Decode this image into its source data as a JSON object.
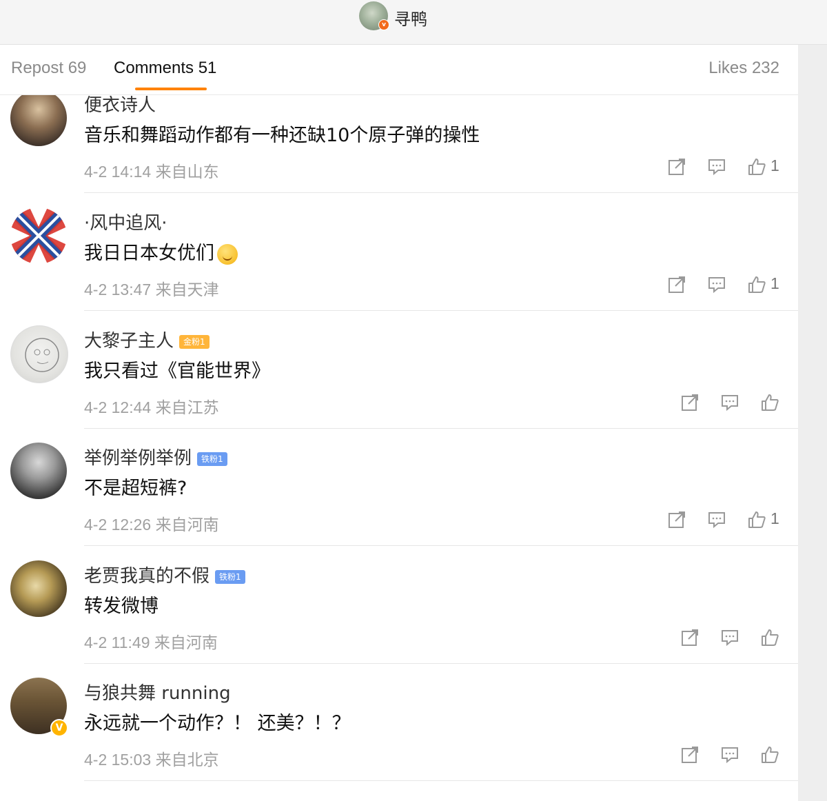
{
  "header": {
    "title": "寻鸭",
    "avatar_badge": "v"
  },
  "tabs": {
    "repost": "Repost 69",
    "comments": "Comments 51",
    "likes": "Likes 232"
  },
  "colors": {
    "accent": "#ff8200",
    "gold_fan": "#ffb53a",
    "iron_fan": "#6a9cf2",
    "verified": "#ffb400"
  },
  "comments": [
    {
      "user": "便衣诗人",
      "text": "音乐和舞蹈动作都有一种还缺10个原子弹的操性",
      "time": "4-2 14:14 来自山东",
      "likes": "1"
    },
    {
      "user": "·风中追风·",
      "text": "我日日本女优们",
      "emoji": "smirk-emoji",
      "time": "4-2 13:47 来自天津",
      "likes": "1"
    },
    {
      "user": "大黎子主人",
      "badge": "金粉1",
      "text": "我只看过《官能世界》",
      "time": "4-2 12:44 来自江苏",
      "likes": ""
    },
    {
      "user": "举例举例举例",
      "badge": "铁粉1",
      "text": "不是超短裤?",
      "time": "4-2 12:26 来自河南",
      "likes": "1"
    },
    {
      "user": "老贾我真的不假",
      "badge": "铁粉1",
      "text": "转发微博",
      "time": "4-2 11:49 来自河南",
      "likes": ""
    },
    {
      "user": "与狼共舞 running",
      "verified": "V",
      "text": "永远就一个动作？！ 还美？！？",
      "time": "4-2 15:03 来自北京",
      "likes": ""
    }
  ]
}
